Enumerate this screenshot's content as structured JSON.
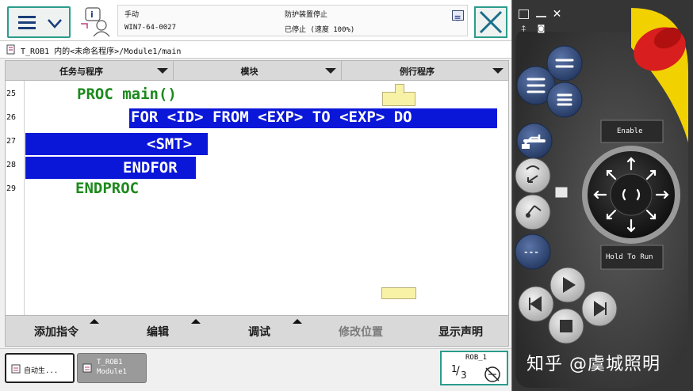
{
  "header": {
    "mode_label": "手动",
    "controller_id": "WIN7-64-0027",
    "safety_status": "防护装置停止",
    "run_status": "已停止 (速度 100%)"
  },
  "path": "T_ROB1 内的<未命名程序>/Module1/main",
  "tabs": [
    {
      "label": "任务与程序"
    },
    {
      "label": "模块"
    },
    {
      "label": "例行程序"
    }
  ],
  "code": {
    "line_numbers": [
      "25",
      "26",
      "27",
      "28",
      "29"
    ],
    "lines": [
      "PROC main()",
      "FOR <ID> FROM <EXP> TO <EXP> DO",
      "<SMT>",
      "ENDFOR",
      "ENDPROC"
    ]
  },
  "bottom_menu": [
    {
      "label": "添加指令",
      "enabled": true
    },
    {
      "label": "编辑",
      "enabled": true
    },
    {
      "label": "调试",
      "enabled": true
    },
    {
      "label": "修改位置",
      "enabled": false
    },
    {
      "label": "显示声明",
      "enabled": true
    }
  ],
  "taskbar": {
    "task1": "自动生...",
    "task2_line1": "T_ROB1",
    "task2_line2": "Module1",
    "quickset_robot": "ROB_1",
    "quickset_fraction_num": "1",
    "quickset_fraction_den": "3"
  },
  "pendant": {
    "enable_label": "Enable",
    "hold_label": "Hold To Run",
    "dash_label": "---"
  },
  "watermark": "知乎 @虞城照明",
  "colors": {
    "teal": "#2b9c8b",
    "selection_blue": "#0a17d8",
    "keyword_green": "#1c8a1c",
    "estop_red": "#d81e1e",
    "guard_yellow": "#f2d100"
  }
}
